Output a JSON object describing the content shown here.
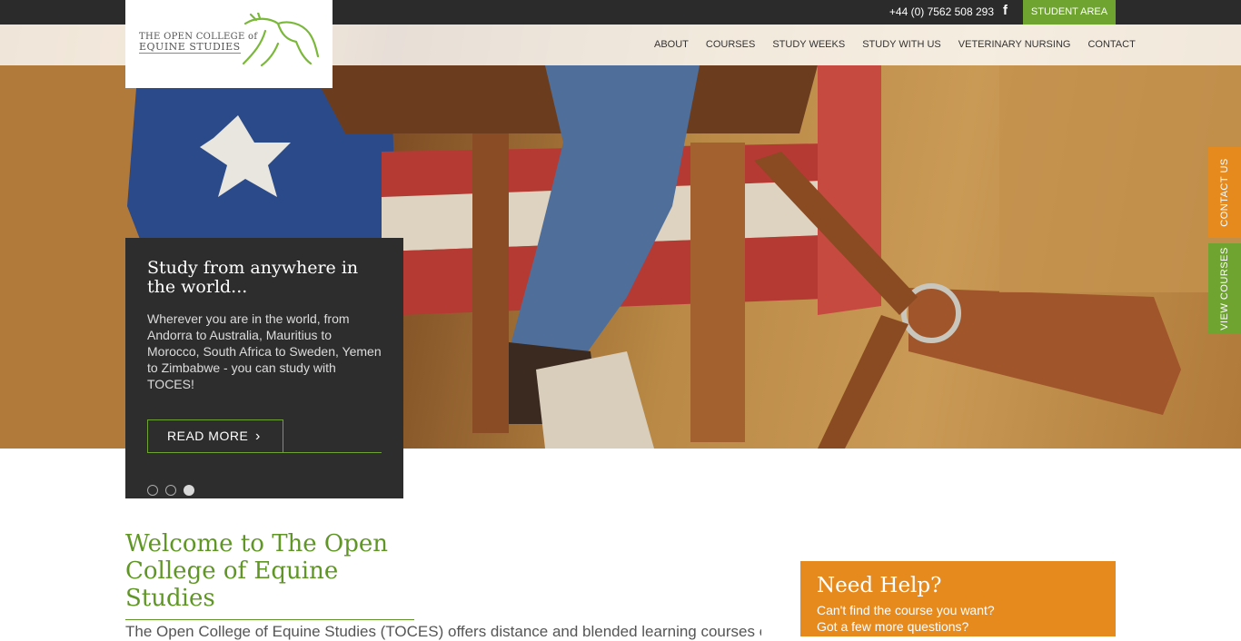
{
  "topbar": {
    "phone": "+44 (0) 7562 508 293",
    "facebook_icon": "facebook-icon",
    "student_area": "STUDENT AREA"
  },
  "logo": {
    "line1": "THE OPEN COLLEGE of",
    "line2": "EQUINE STUDIES"
  },
  "nav": {
    "items": [
      "ABOUT",
      "COURSES",
      "STUDY WEEKS",
      "STUDY WITH US",
      "VETERINARY NURSING",
      "CONTACT"
    ]
  },
  "side_tabs": {
    "contact": "CONTACT US",
    "courses": "VIEW COURSES"
  },
  "slide": {
    "title": "Study from anywhere in the world...",
    "body": "Wherever you are in the world, from Andorra to Australia, Mauritius to Morocco, South Africa to Sweden, Yemen to Zimbabwe - you can study with TOCES!",
    "read_more": "READ MORE",
    "chevron": "›",
    "active_dot": 3,
    "dot_count": 3
  },
  "welcome": {
    "title": "Welcome to The Open College of Equine Studies",
    "intro": "The Open College of Equine Studies (TOCES) offers distance and blended learning courses covering a"
  },
  "help": {
    "title": "Need Help?",
    "line1": "Can't find the course you want?",
    "line2": "Got a few more questions?"
  },
  "colors": {
    "green": "#6ea42f",
    "orange": "#e68a1e",
    "dark": "#2d2d2d"
  }
}
